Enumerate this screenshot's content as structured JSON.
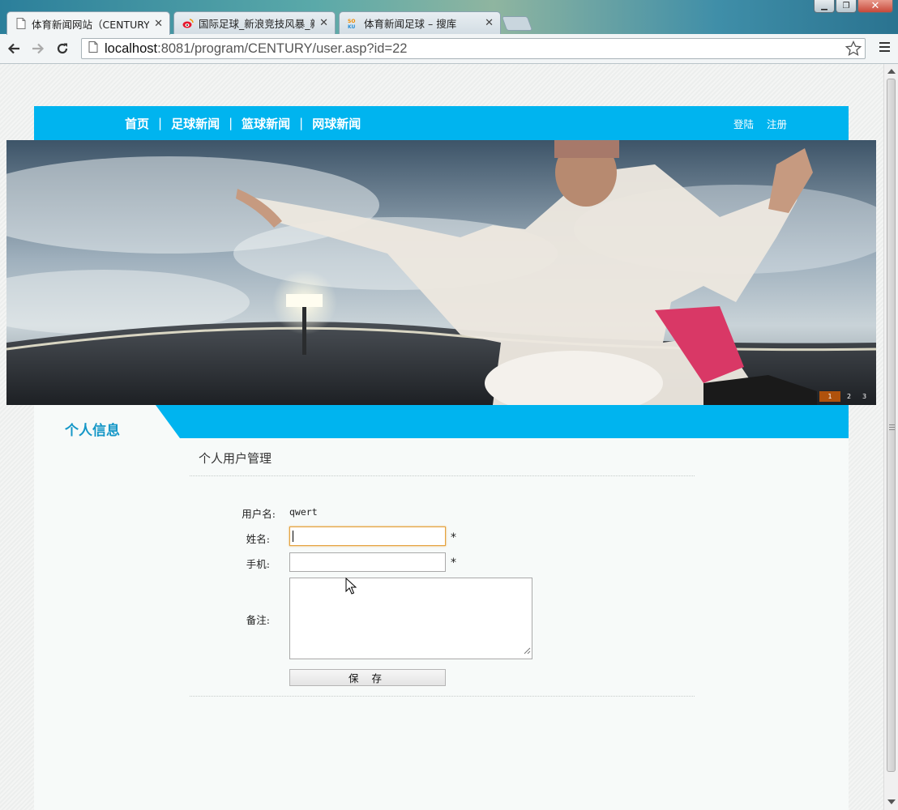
{
  "browser": {
    "tabs": [
      {
        "title": "体育新闻网站（CENTURY",
        "active": true
      },
      {
        "title": "国际足球_新浪竞技风暴_新",
        "active": false
      },
      {
        "title": "体育新闻足球 – 搜库",
        "active": false
      }
    ],
    "url_host": "localhost",
    "url_rest": ":8081/program/CENTURY/user.asp?id=22"
  },
  "site": {
    "nav": [
      "首页",
      "足球新闻",
      "篮球新闻",
      "网球新闻"
    ],
    "nav_separator": "|",
    "login": "登陆",
    "register": "注册",
    "slider_dots": [
      "1",
      "2",
      "3"
    ],
    "slider_active": 1,
    "section_title": "个人信息",
    "accent_color": "#00b4ef"
  },
  "form": {
    "title": "个人用户管理",
    "username_label": "用户名:",
    "username_value": "qwert",
    "name_label": "姓名:",
    "name_value": "",
    "phone_label": "手机:",
    "phone_value": "",
    "note_label": "备注:",
    "note_value": "",
    "required_mark": "*",
    "save_label": "保 存"
  }
}
